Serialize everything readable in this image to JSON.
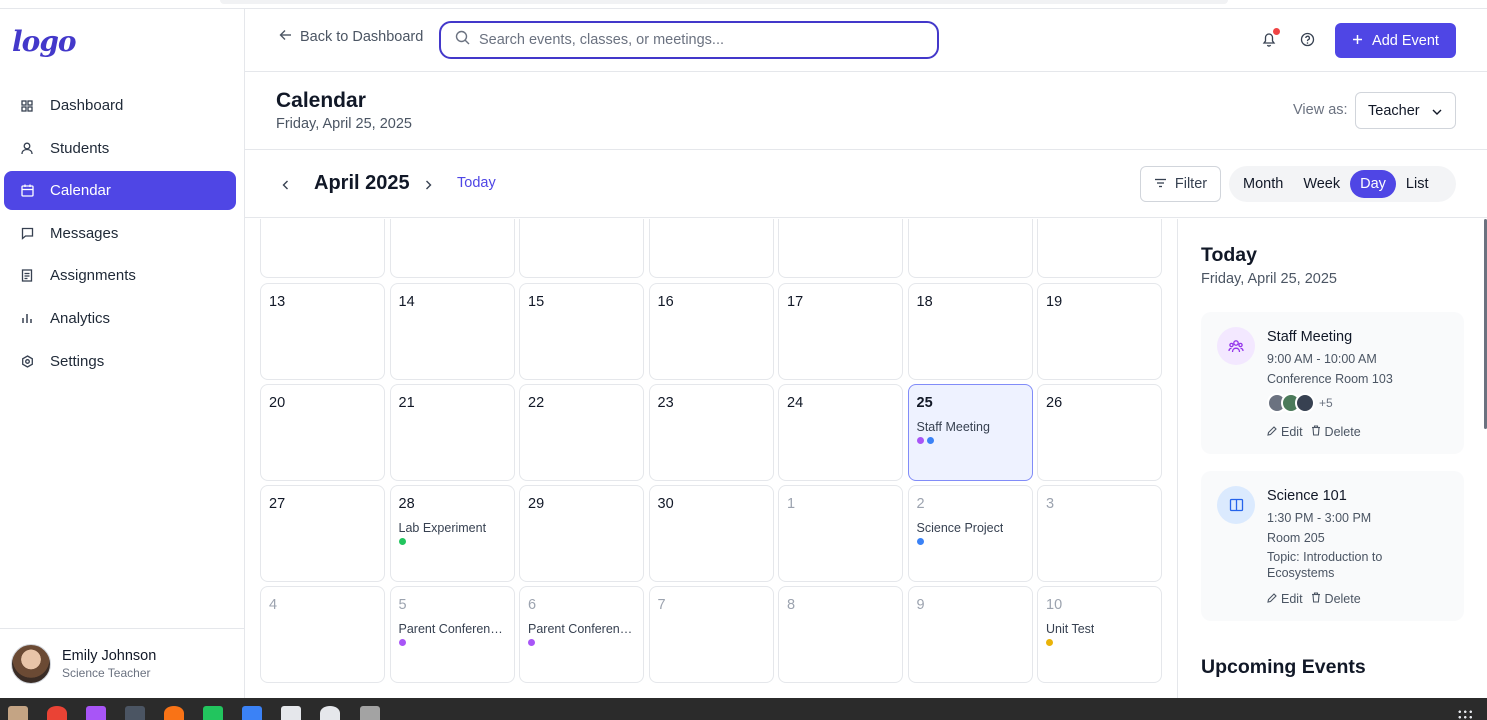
{
  "brand": {
    "logo_text": "logo",
    "accent": "#4f46e5"
  },
  "sidebar": {
    "items": [
      {
        "label": "Dashboard",
        "icon": "grid-icon",
        "active": false
      },
      {
        "label": "Students",
        "icon": "user-icon",
        "active": false
      },
      {
        "label": "Calendar",
        "icon": "calendar-icon",
        "active": true
      },
      {
        "label": "Messages",
        "icon": "message-icon",
        "active": false
      },
      {
        "label": "Assignments",
        "icon": "document-icon",
        "active": false
      },
      {
        "label": "Analytics",
        "icon": "bar-chart-icon",
        "active": false
      },
      {
        "label": "Settings",
        "icon": "gear-icon",
        "active": false
      }
    ],
    "profile": {
      "name": "Emily Johnson",
      "role": "Science Teacher"
    }
  },
  "header": {
    "back_label": "Back to Dashboard",
    "search_placeholder": "Search events, classes, or meetings...",
    "add_event_label": "Add Event",
    "notification_dot_color": "#ef4444"
  },
  "page": {
    "title": "Calendar",
    "date": "Friday, April 25, 2025",
    "view_as_label": "View as:",
    "view_as_value": "Teacher"
  },
  "toolbar": {
    "month_label": "April 2025",
    "today_label": "Today",
    "filter_label": "Filter",
    "views": [
      "Month",
      "Week",
      "Day",
      "List"
    ],
    "active_view": "Day"
  },
  "calendar": {
    "weeks": [
      [
        {
          "day": ""
        },
        {
          "day": ""
        },
        {
          "day": ""
        },
        {
          "day": ""
        },
        {
          "day": ""
        },
        {
          "day": ""
        },
        {
          "day": ""
        }
      ],
      [
        {
          "day": "13"
        },
        {
          "day": "14"
        },
        {
          "day": "15"
        },
        {
          "day": "16"
        },
        {
          "day": "17"
        },
        {
          "day": "18"
        },
        {
          "day": "19"
        }
      ],
      [
        {
          "day": "20"
        },
        {
          "day": "21"
        },
        {
          "day": "22"
        },
        {
          "day": "23"
        },
        {
          "day": "24"
        },
        {
          "day": "25",
          "today": true,
          "event": "Staff Meeting",
          "dots": [
            "#a855f7",
            "#3b82f6"
          ]
        },
        {
          "day": "26"
        }
      ],
      [
        {
          "day": "27"
        },
        {
          "day": "28",
          "event": "Lab Experiment",
          "dots": [
            "#22c55e"
          ]
        },
        {
          "day": "29"
        },
        {
          "day": "30"
        },
        {
          "day": "1",
          "other": true
        },
        {
          "day": "2",
          "other": true,
          "event": "Science Project",
          "dots": [
            "#3b82f6"
          ]
        },
        {
          "day": "3",
          "other": true
        }
      ],
      [
        {
          "day": "4",
          "other": true
        },
        {
          "day": "5",
          "other": true,
          "event": "Parent Conference...",
          "dots": [
            "#a855f7"
          ]
        },
        {
          "day": "6",
          "other": true,
          "event": "Parent Conference...",
          "dots": [
            "#a855f7"
          ]
        },
        {
          "day": "7",
          "other": true
        },
        {
          "day": "8",
          "other": true
        },
        {
          "day": "9",
          "other": true
        },
        {
          "day": "10",
          "other": true,
          "event": "Unit Test",
          "dots": [
            "#eab308"
          ]
        }
      ]
    ]
  },
  "panel": {
    "title": "Today",
    "date": "Friday, April 25, 2025",
    "events": [
      {
        "title": "Staff Meeting",
        "time": "9:00 AM - 10:00 AM",
        "location": "Conference Room 103",
        "attendees_more": "+5",
        "icon": "people-icon",
        "icon_bg": "#f3e8ff",
        "icon_color": "#9333ea"
      },
      {
        "title": "Science 101",
        "time": "1:30 PM - 3:00 PM",
        "location": "Room 205",
        "topic": "Topic: Introduction to Ecosystems",
        "icon": "book-icon",
        "icon_bg": "#dbeafe",
        "icon_color": "#2563eb"
      }
    ],
    "edit_label": "Edit",
    "delete_label": "Delete",
    "upcoming_title": "Upcoming Events"
  }
}
